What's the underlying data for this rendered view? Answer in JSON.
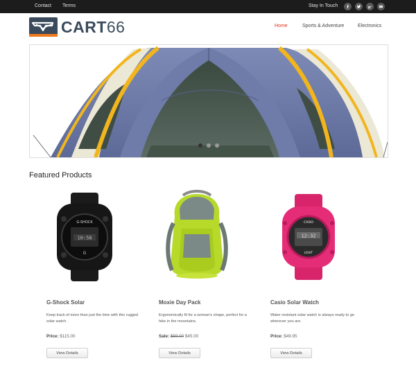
{
  "topbar": {
    "links": [
      "Contact",
      "Terms"
    ],
    "stay_in_touch": "Stay In Touch",
    "social_icons": [
      "facebook-icon",
      "twitter-icon",
      "google-plus-icon",
      "youtube-icon"
    ]
  },
  "header": {
    "logo": {
      "text_bold": "CART",
      "text_num": "66"
    },
    "nav": [
      {
        "label": "Home",
        "active": true
      },
      {
        "label": "Sports & Adventure",
        "active": false
      },
      {
        "label": "Electronics",
        "active": false
      }
    ]
  },
  "hero": {
    "slide_count": 3,
    "active_slide": 1
  },
  "featured": {
    "title": "Featured Products",
    "products": [
      {
        "name": "G-Shock Solar",
        "desc": "Keep track of more than just the time with this rugged solar watch.",
        "price_label": "Price:",
        "price": "$115.00",
        "old_price": "",
        "button": "View Details"
      },
      {
        "name": "Moxie Day Pack",
        "desc": "Ergonomically fit for a woman's shape, perfect for a hike in the mountains.",
        "price_label": "Sale:",
        "price": "$45.00",
        "old_price": "$59.00",
        "button": "View Details"
      },
      {
        "name": "Casio Solar Watch",
        "desc": "Water resistant solar watch is always ready to go wherever you are.",
        "price_label": "Price:",
        "price": "$49.95",
        "old_price": "",
        "button": "View Details"
      }
    ]
  },
  "colors": {
    "topbar_bg": "#1c1c1c",
    "nav_active": "#e0321e",
    "logo_blue": "#3a4a5c",
    "logo_orange": "#f07a1c",
    "dot_active": "#333333",
    "dot_inactive": "#9a9a9a"
  }
}
